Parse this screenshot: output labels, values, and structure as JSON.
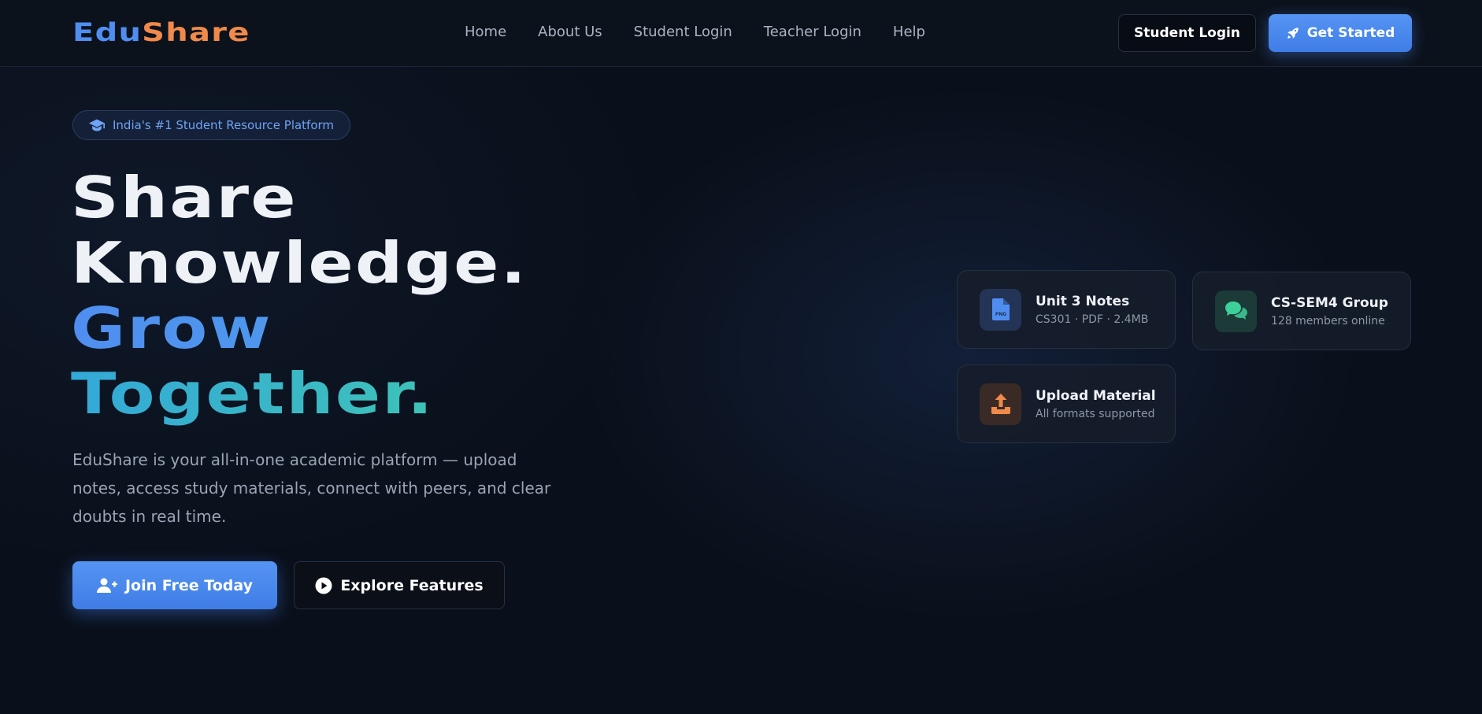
{
  "brand": {
    "part1": "Edu",
    "part2": "Share"
  },
  "nav": {
    "links": [
      "Home",
      "About Us",
      "Student Login",
      "Teacher Login",
      "Help"
    ],
    "login_label": "Student Login",
    "started_label": "Get Started"
  },
  "hero": {
    "badge": "India's #1 Student Resource Platform",
    "line1": "Share",
    "line2": "Knowledge.",
    "line3": "Grow",
    "line4": "Together.",
    "description": "EduShare is your all-in-one academic platform — upload notes, access study materials, connect with peers, and clear doubts in real time.",
    "join_label": "Join Free Today",
    "explore_label": "Explore Features"
  },
  "cards": [
    {
      "title": "Unit 3 Notes",
      "subtitle": "CS301 · PDF · 2.4MB",
      "icon": "png-file-icon",
      "color": "#4f8ef0"
    },
    {
      "title": "CS-SEM4 Group",
      "subtitle": "128 members online",
      "icon": "chat-icon",
      "color": "#3fcf9a"
    },
    {
      "title": "Upload Material",
      "subtitle": "All formats supported",
      "icon": "upload-icon",
      "color": "#f08a4b"
    }
  ],
  "colors": {
    "accent": "#4f8ef0",
    "orange": "#f08a4b",
    "teal": "#40c9b0",
    "background": "#0a101b"
  }
}
